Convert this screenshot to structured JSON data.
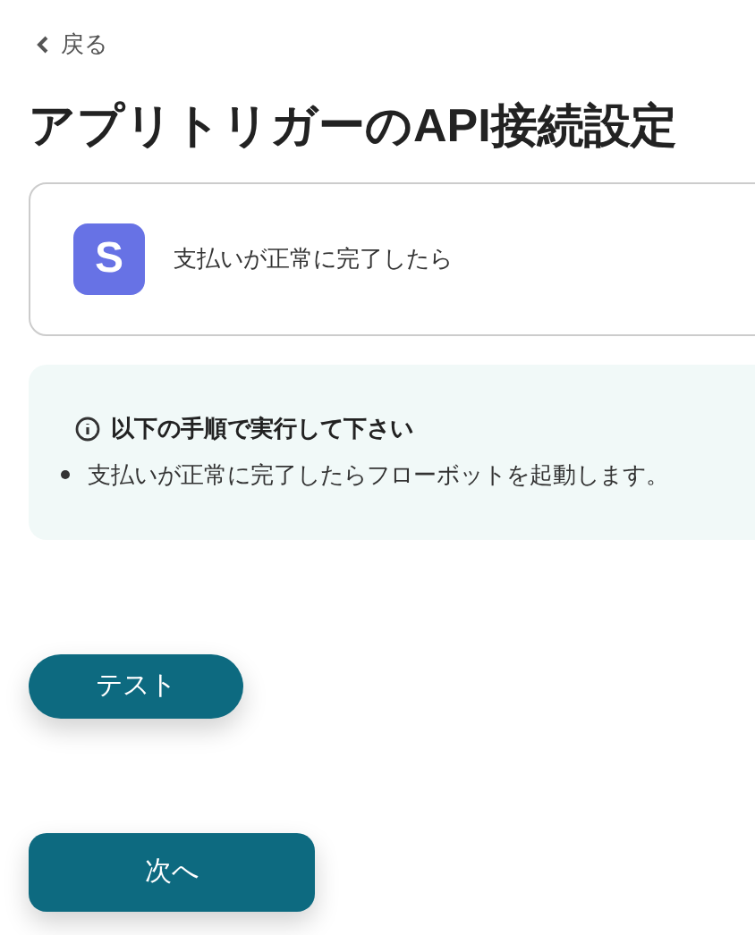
{
  "back_link": {
    "label": "戻る"
  },
  "title": "アプリトリガーのAPI接続設定",
  "trigger_card": {
    "app_letter": "S",
    "label": "支払いが正常に完了したら"
  },
  "notice": {
    "heading": "以下の手順で実行して下さい",
    "items": [
      "支払いが正常に完了したらフローボットを起動します。"
    ]
  },
  "buttons": {
    "test": "テスト",
    "next": "次へ"
  }
}
